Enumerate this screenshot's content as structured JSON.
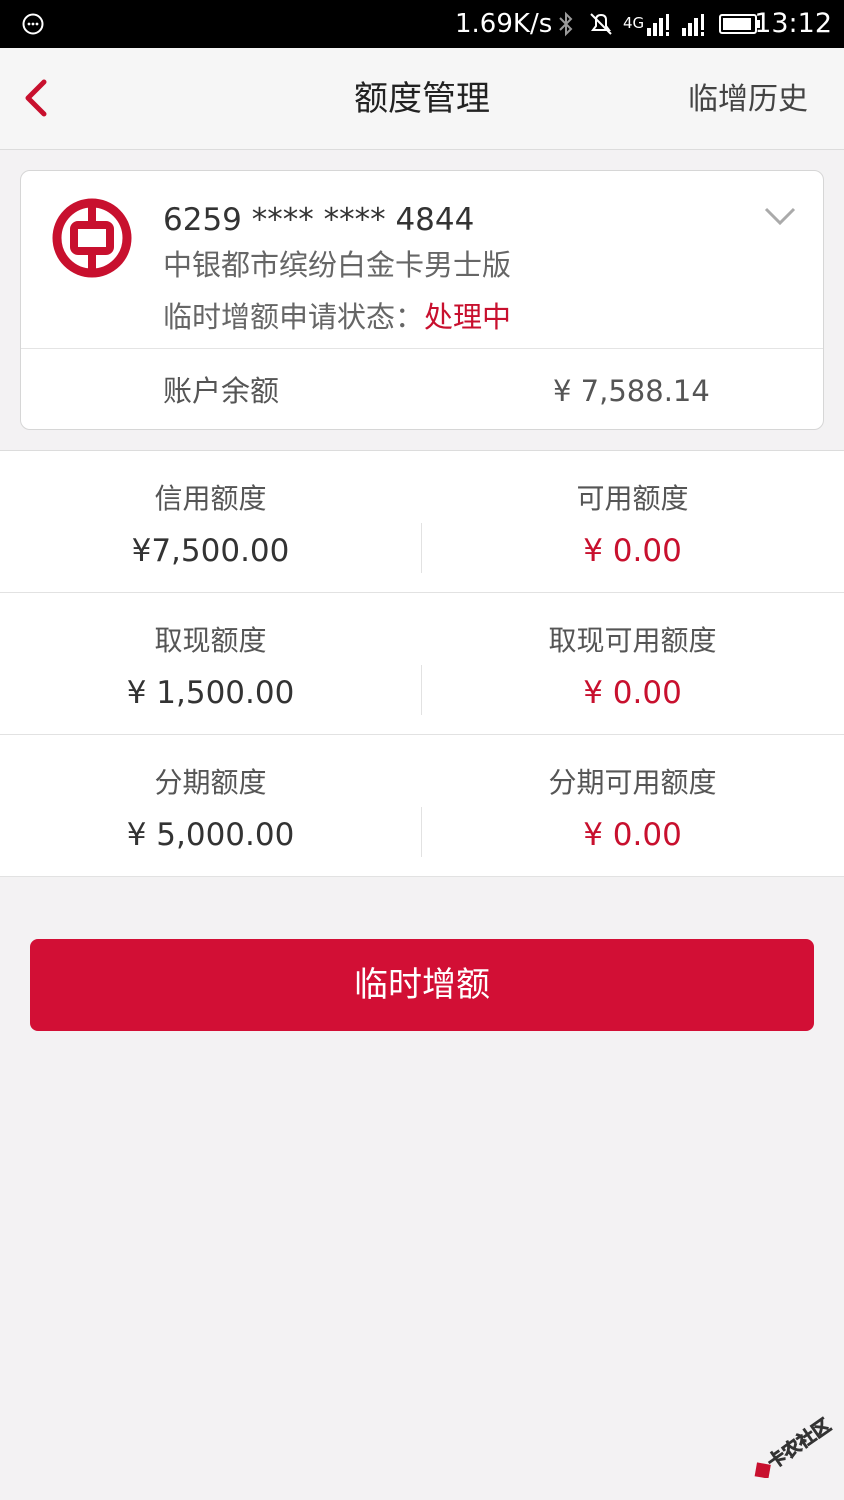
{
  "status_bar": {
    "network_speed": "1.69K/s",
    "network_type": "4G",
    "time": "13:12",
    "icons": [
      "message-icon",
      "bluetooth-icon",
      "mute-icon",
      "signal-icon",
      "signal-icon",
      "battery-icon"
    ]
  },
  "nav": {
    "title": "额度管理",
    "right_action": "临增历史",
    "back_icon": "chevron-left-icon"
  },
  "card": {
    "number": "6259 **** **** 4844",
    "name": "中银都市缤纷白金卡男士版",
    "status_label": "临时增额申请状态：",
    "status_value": "处理中",
    "balance_label": "账户余额",
    "balance_value": "¥ 7,588.14",
    "logo": "bank-of-china-logo",
    "expand_icon": "chevron-down-icon"
  },
  "limits": {
    "rows": [
      {
        "left": {
          "label": "信用额度",
          "value": "¥7,500.00"
        },
        "right": {
          "label": "可用额度",
          "value": "¥ 0.00"
        }
      },
      {
        "left": {
          "label": "取现额度",
          "value": "¥ 1,500.00"
        },
        "right": {
          "label": "取现可用额度",
          "value": "¥ 0.00"
        }
      },
      {
        "left": {
          "label": "分期额度",
          "value": "¥ 5,000.00"
        },
        "right": {
          "label": "分期可用额度",
          "value": "¥ 0.00"
        }
      }
    ]
  },
  "action": {
    "label": "临时增额"
  },
  "watermark": {
    "text": "卡农社区"
  },
  "colors": {
    "accent": "#c8102e",
    "button": "#d20f35",
    "background": "#f3f2f3",
    "status_bar": "#000000"
  }
}
